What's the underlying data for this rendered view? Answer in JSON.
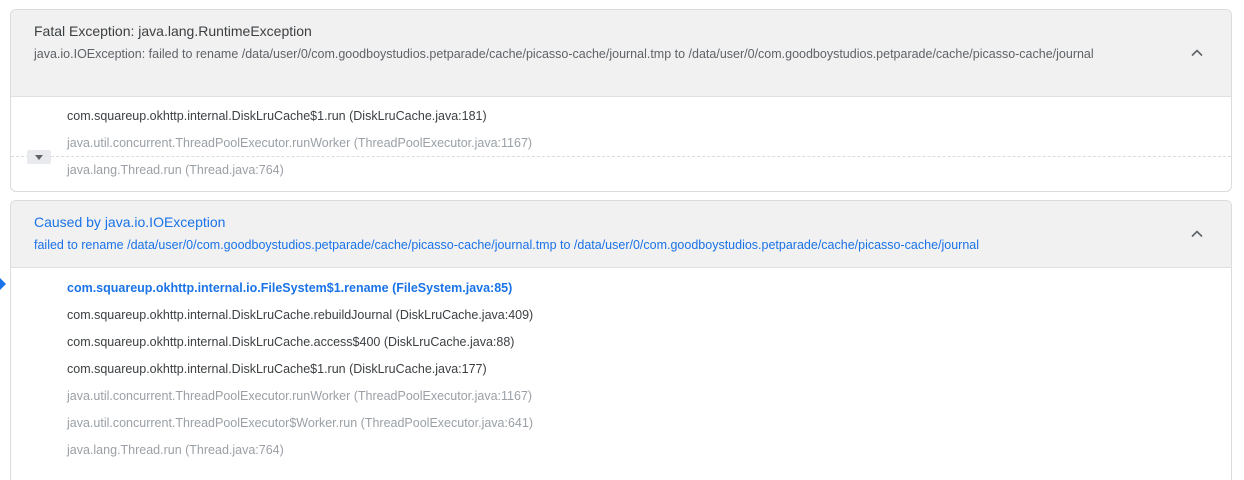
{
  "fatal": {
    "title": "Fatal Exception: java.lang.RuntimeException",
    "message": "java.io.IOException: failed to rename /data/user/0/com.goodboystudios.petparade/cache/picasso-cache/journal.tmp to /data/user/0/com.goodboystudios.petparade/cache/picasso-cache/journal",
    "collapse_icon": "chevron-up-icon",
    "expand_icon": "chevron-down-icon",
    "frames": [
      "com.squareup.okhttp.internal.DiskLruCache$1.run (DiskLruCache.java:181)",
      "java.util.concurrent.ThreadPoolExecutor.runWorker (ThreadPoolExecutor.java:1167)",
      "java.lang.Thread.run (Thread.java:764)"
    ]
  },
  "caused": {
    "title": "Caused by java.io.IOException",
    "message": "failed to rename /data/user/0/com.goodboystudios.petparade/cache/picasso-cache/journal.tmp to /data/user/0/com.goodboystudios.petparade/cache/picasso-cache/journal",
    "collapse_icon": "chevron-up-icon",
    "frames": [
      "com.squareup.okhttp.internal.io.FileSystem$1.rename (FileSystem.java:85)",
      "com.squareup.okhttp.internal.DiskLruCache.rebuildJournal (DiskLruCache.java:409)",
      "com.squareup.okhttp.internal.DiskLruCache.access$400 (DiskLruCache.java:88)",
      "com.squareup.okhttp.internal.DiskLruCache$1.run (DiskLruCache.java:177)",
      "java.util.concurrent.ThreadPoolExecutor.runWorker (ThreadPoolExecutor.java:1167)",
      "java.util.concurrent.ThreadPoolExecutor$Worker.run (ThreadPoolExecutor.java:641)",
      "java.lang.Thread.run (Thread.java:764)"
    ]
  },
  "colors": {
    "accent": "#1a73e8",
    "header_bg": "#f1f1f1",
    "library_frame_text": "#9aa0a6",
    "app_frame_text": "#3c4043"
  }
}
